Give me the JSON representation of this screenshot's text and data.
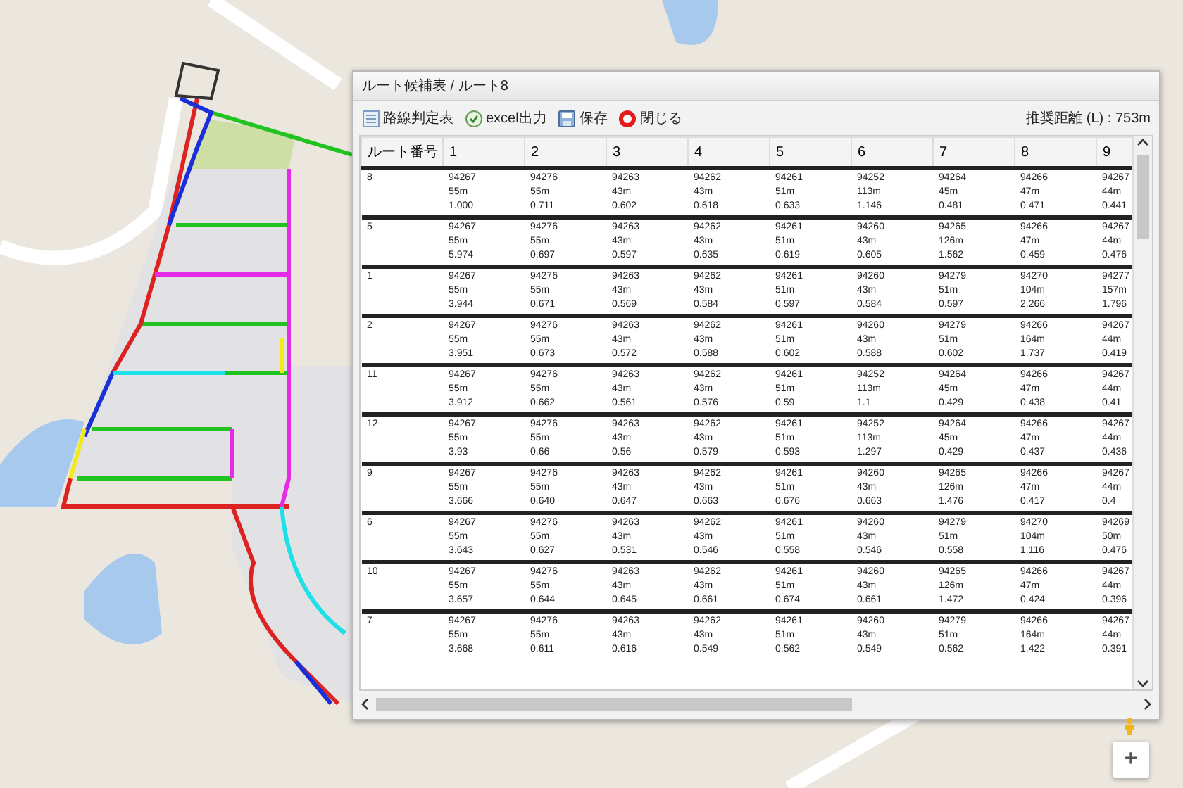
{
  "dialog": {
    "title": "ルート候補表 / ルート8",
    "toolbar": [
      {
        "kind": "table",
        "label": "路線判定表"
      },
      {
        "kind": "excel",
        "label": "excel出力"
      },
      {
        "kind": "save",
        "label": "保存"
      },
      {
        "kind": "close",
        "label": "閉じる"
      }
    ],
    "summary": "推奨距離 (L) : 753m",
    "table": {
      "columns": [
        "ルート番号",
        "1",
        "2",
        "3",
        "4",
        "5",
        "6",
        "7",
        "8",
        "9"
      ],
      "rows": [
        {
          "cells": [
            [
              "8"
            ],
            [
              "94267",
              "55m",
              "1.000"
            ],
            [
              "94276",
              "55m",
              "0.711"
            ],
            [
              "94263",
              "43m",
              "0.602"
            ],
            [
              "94262",
              "43m",
              "0.618"
            ],
            [
              "94261",
              "51m",
              "0.633"
            ],
            [
              "94252",
              "113m",
              "1.146"
            ],
            [
              "94264",
              "45m",
              "0.481"
            ],
            [
              "94266",
              "47m",
              "0.471"
            ],
            [
              "94267",
              "44m",
              "0.441"
            ]
          ]
        },
        {
          "cells": [
            [
              "5"
            ],
            [
              "94267",
              "55m",
              "5.974"
            ],
            [
              "94276",
              "55m",
              "0.697"
            ],
            [
              "94263",
              "43m",
              "0.597"
            ],
            [
              "94262",
              "43m",
              "0.635"
            ],
            [
              "94261",
              "51m",
              "0.619"
            ],
            [
              "94260",
              "43m",
              "0.605"
            ],
            [
              "94265",
              "126m",
              "1.562"
            ],
            [
              "94266",
              "47m",
              "0.459"
            ],
            [
              "94267",
              "44m",
              "0.476"
            ]
          ]
        },
        {
          "cells": [
            [
              "1"
            ],
            [
              "94267",
              "55m",
              "3.944"
            ],
            [
              "94276",
              "55m",
              "0.671"
            ],
            [
              "94263",
              "43m",
              "0.569"
            ],
            [
              "94262",
              "43m",
              "0.584"
            ],
            [
              "94261",
              "51m",
              "0.597"
            ],
            [
              "94260",
              "43m",
              "0.584"
            ],
            [
              "94279",
              "51m",
              "0.597"
            ],
            [
              "94270",
              "104m",
              "2.266"
            ],
            [
              "94277",
              "157m",
              "1.796"
            ]
          ]
        },
        {
          "cells": [
            [
              "2"
            ],
            [
              "94267",
              "55m",
              "3.951"
            ],
            [
              "94276",
              "55m",
              "0.673"
            ],
            [
              "94263",
              "43m",
              "0.572"
            ],
            [
              "94262",
              "43m",
              "0.588"
            ],
            [
              "94261",
              "51m",
              "0.602"
            ],
            [
              "94260",
              "43m",
              "0.588"
            ],
            [
              "94279",
              "51m",
              "0.602"
            ],
            [
              "94266",
              "164m",
              "1.737"
            ],
            [
              "94267",
              "44m",
              "0.419"
            ]
          ]
        },
        {
          "cells": [
            [
              "11"
            ],
            [
              "94267",
              "55m",
              "3.912"
            ],
            [
              "94276",
              "55m",
              "0.662"
            ],
            [
              "94263",
              "43m",
              "0.561"
            ],
            [
              "94262",
              "43m",
              "0.576"
            ],
            [
              "94261",
              "51m",
              "0.59"
            ],
            [
              "94252",
              "113m",
              "1.1"
            ],
            [
              "94264",
              "45m",
              "0.429"
            ],
            [
              "94266",
              "47m",
              "0.438"
            ],
            [
              "94267",
              "44m",
              "0.41"
            ]
          ]
        },
        {
          "cells": [
            [
              "12"
            ],
            [
              "94267",
              "55m",
              "3.93"
            ],
            [
              "94276",
              "55m",
              "0.66"
            ],
            [
              "94263",
              "43m",
              "0.56"
            ],
            [
              "94262",
              "43m",
              "0.579"
            ],
            [
              "94261",
              "51m",
              "0.593"
            ],
            [
              "94252",
              "113m",
              "1.297"
            ],
            [
              "94264",
              "45m",
              "0.429"
            ],
            [
              "94266",
              "47m",
              "0.437"
            ],
            [
              "94267",
              "44m",
              "0.436"
            ]
          ]
        },
        {
          "cells": [
            [
              "9"
            ],
            [
              "94267",
              "55m",
              "3.666"
            ],
            [
              "94276",
              "55m",
              "0.640"
            ],
            [
              "94263",
              "43m",
              "0.647"
            ],
            [
              "94262",
              "43m",
              "0.663"
            ],
            [
              "94261",
              "51m",
              "0.676"
            ],
            [
              "94260",
              "43m",
              "0.663"
            ],
            [
              "94265",
              "126m",
              "1.476"
            ],
            [
              "94266",
              "47m",
              "0.417"
            ],
            [
              "94267",
              "44m",
              "0.4"
            ]
          ]
        },
        {
          "cells": [
            [
              "6"
            ],
            [
              "94267",
              "55m",
              "3.643"
            ],
            [
              "94276",
              "55m",
              "0.627"
            ],
            [
              "94263",
              "43m",
              "0.531"
            ],
            [
              "94262",
              "43m",
              "0.546"
            ],
            [
              "94261",
              "51m",
              "0.558"
            ],
            [
              "94260",
              "43m",
              "0.546"
            ],
            [
              "94279",
              "51m",
              "0.558"
            ],
            [
              "94270",
              "104m",
              "1.116"
            ],
            [
              "94269",
              "50m",
              "0.476"
            ]
          ]
        },
        {
          "cells": [
            [
              "10"
            ],
            [
              "94267",
              "55m",
              "3.657"
            ],
            [
              "94276",
              "55m",
              "0.644"
            ],
            [
              "94263",
              "43m",
              "0.645"
            ],
            [
              "94262",
              "43m",
              "0.661"
            ],
            [
              "94261",
              "51m",
              "0.674"
            ],
            [
              "94260",
              "43m",
              "0.661"
            ],
            [
              "94265",
              "126m",
              "1.472"
            ],
            [
              "94266",
              "47m",
              "0.424"
            ],
            [
              "94267",
              "44m",
              "0.396"
            ]
          ]
        },
        {
          "cells": [
            [
              "7"
            ],
            [
              "94267",
              "55m",
              "3.668"
            ],
            [
              "94276",
              "55m",
              "0.611"
            ],
            [
              "94263",
              "43m",
              "0.616"
            ],
            [
              "94262",
              "43m",
              "0.549"
            ],
            [
              "94261",
              "51m",
              "0.562"
            ],
            [
              "94260",
              "43m",
              "0.549"
            ],
            [
              "94279",
              "51m",
              "0.562"
            ],
            [
              "94266",
              "164m",
              "1.422"
            ],
            [
              "94267",
              "44m",
              "0.391"
            ]
          ]
        }
      ]
    }
  },
  "map_controls": {
    "zoom_in": "+"
  }
}
